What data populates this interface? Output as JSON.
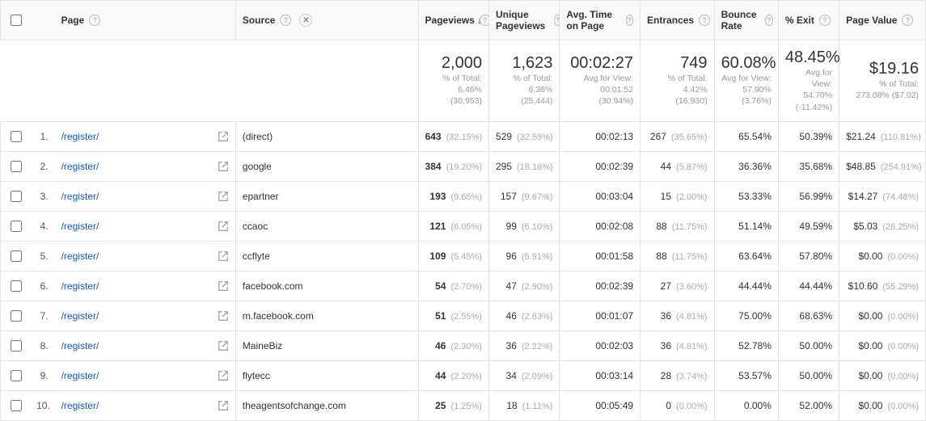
{
  "columns": {
    "page": "Page",
    "source": "Source",
    "pageviews": "Pageviews",
    "unique": "Unique Pageviews",
    "avgtime": "Avg. Time on Page",
    "entrances": "Entrances",
    "bounce": "Bounce Rate",
    "exit": "% Exit",
    "value": "Page Value"
  },
  "summary": {
    "pageviews": {
      "big": "2,000",
      "sub1": "% of Total:",
      "sub2": "6.46%",
      "sub3": "(30,953)"
    },
    "unique": {
      "big": "1,623",
      "sub1": "% of Total:",
      "sub2": "6.38%",
      "sub3": "(25,444)"
    },
    "avgtime": {
      "big": "00:02:27",
      "sub1": "Avg for View:",
      "sub2": "00:01:52",
      "sub3": "(30.94%)"
    },
    "entrances": {
      "big": "749",
      "sub1": "% of Total:",
      "sub2": "4.42%",
      "sub3": "(16,930)"
    },
    "bounce": {
      "big": "60.08%",
      "sub1": "Avg for View:",
      "sub2": "57.90%",
      "sub3": "(3.76%)"
    },
    "exit": {
      "big": "48.45%",
      "sub1": "Avg for View:",
      "sub2": "54.70%",
      "sub3": "(-11.42%)"
    },
    "value": {
      "big": "$19.16",
      "sub1": "% of Total:",
      "sub2": "273.08% ($7.02)",
      "sub3": ""
    }
  },
  "rows": [
    {
      "idx": "1.",
      "page": "/register/",
      "source": "(direct)",
      "pv": "643",
      "pv_pct": "(32.15%)",
      "upv": "529",
      "upv_pct": "(32.59%)",
      "avg": "00:02:13",
      "ent": "267",
      "ent_pct": "(35.65%)",
      "br": "65.54%",
      "ex": "50.39%",
      "val": "$21.24",
      "val_pct": "(110.81%)"
    },
    {
      "idx": "2.",
      "page": "/register/",
      "source": "google",
      "pv": "384",
      "pv_pct": "(19.20%)",
      "upv": "295",
      "upv_pct": "(18.18%)",
      "avg": "00:02:39",
      "ent": "44",
      "ent_pct": "(5.87%)",
      "br": "36.36%",
      "ex": "35.68%",
      "val": "$48.85",
      "val_pct": "(254.91%)"
    },
    {
      "idx": "3.",
      "page": "/register/",
      "source": "epartner",
      "pv": "193",
      "pv_pct": "(9.65%)",
      "upv": "157",
      "upv_pct": "(9.67%)",
      "avg": "00:03:04",
      "ent": "15",
      "ent_pct": "(2.00%)",
      "br": "53.33%",
      "ex": "56.99%",
      "val": "$14.27",
      "val_pct": "(74.48%)"
    },
    {
      "idx": "4.",
      "page": "/register/",
      "source": "ccaoc",
      "pv": "121",
      "pv_pct": "(6.05%)",
      "upv": "99",
      "upv_pct": "(6.10%)",
      "avg": "00:02:08",
      "ent": "88",
      "ent_pct": "(11.75%)",
      "br": "51.14%",
      "ex": "49.59%",
      "val": "$5.03",
      "val_pct": "(26.25%)"
    },
    {
      "idx": "5.",
      "page": "/register/",
      "source": "ccflyte",
      "pv": "109",
      "pv_pct": "(5.45%)",
      "upv": "96",
      "upv_pct": "(5.91%)",
      "avg": "00:01:58",
      "ent": "88",
      "ent_pct": "(11.75%)",
      "br": "63.64%",
      "ex": "57.80%",
      "val": "$0.00",
      "val_pct": "(0.00%)"
    },
    {
      "idx": "6.",
      "page": "/register/",
      "source": "facebook.com",
      "pv": "54",
      "pv_pct": "(2.70%)",
      "upv": "47",
      "upv_pct": "(2.90%)",
      "avg": "00:02:39",
      "ent": "27",
      "ent_pct": "(3.60%)",
      "br": "44.44%",
      "ex": "44.44%",
      "val": "$10.60",
      "val_pct": "(55.29%)"
    },
    {
      "idx": "7.",
      "page": "/register/",
      "source": "m.facebook.com",
      "pv": "51",
      "pv_pct": "(2.55%)",
      "upv": "46",
      "upv_pct": "(2.83%)",
      "avg": "00:01:07",
      "ent": "36",
      "ent_pct": "(4.81%)",
      "br": "75.00%",
      "ex": "68.63%",
      "val": "$0.00",
      "val_pct": "(0.00%)"
    },
    {
      "idx": "8.",
      "page": "/register/",
      "source": "MaineBiz",
      "pv": "46",
      "pv_pct": "(2.30%)",
      "upv": "36",
      "upv_pct": "(2.22%)",
      "avg": "00:02:03",
      "ent": "36",
      "ent_pct": "(4.81%)",
      "br": "52.78%",
      "ex": "50.00%",
      "val": "$0.00",
      "val_pct": "(0.00%)"
    },
    {
      "idx": "9.",
      "page": "/register/",
      "source": "flytecc",
      "pv": "44",
      "pv_pct": "(2.20%)",
      "upv": "34",
      "upv_pct": "(2.09%)",
      "avg": "00:03:14",
      "ent": "28",
      "ent_pct": "(3.74%)",
      "br": "53.57%",
      "ex": "50.00%",
      "val": "$0.00",
      "val_pct": "(0.00%)"
    },
    {
      "idx": "10.",
      "page": "/register/",
      "source": "theagentsofchange.com",
      "pv": "25",
      "pv_pct": "(1.25%)",
      "upv": "18",
      "upv_pct": "(1.11%)",
      "avg": "00:05:49",
      "ent": "0",
      "ent_pct": "(0.00%)",
      "br": "0.00%",
      "ex": "52.00%",
      "val": "$0.00",
      "val_pct": "(0.00%)"
    }
  ]
}
